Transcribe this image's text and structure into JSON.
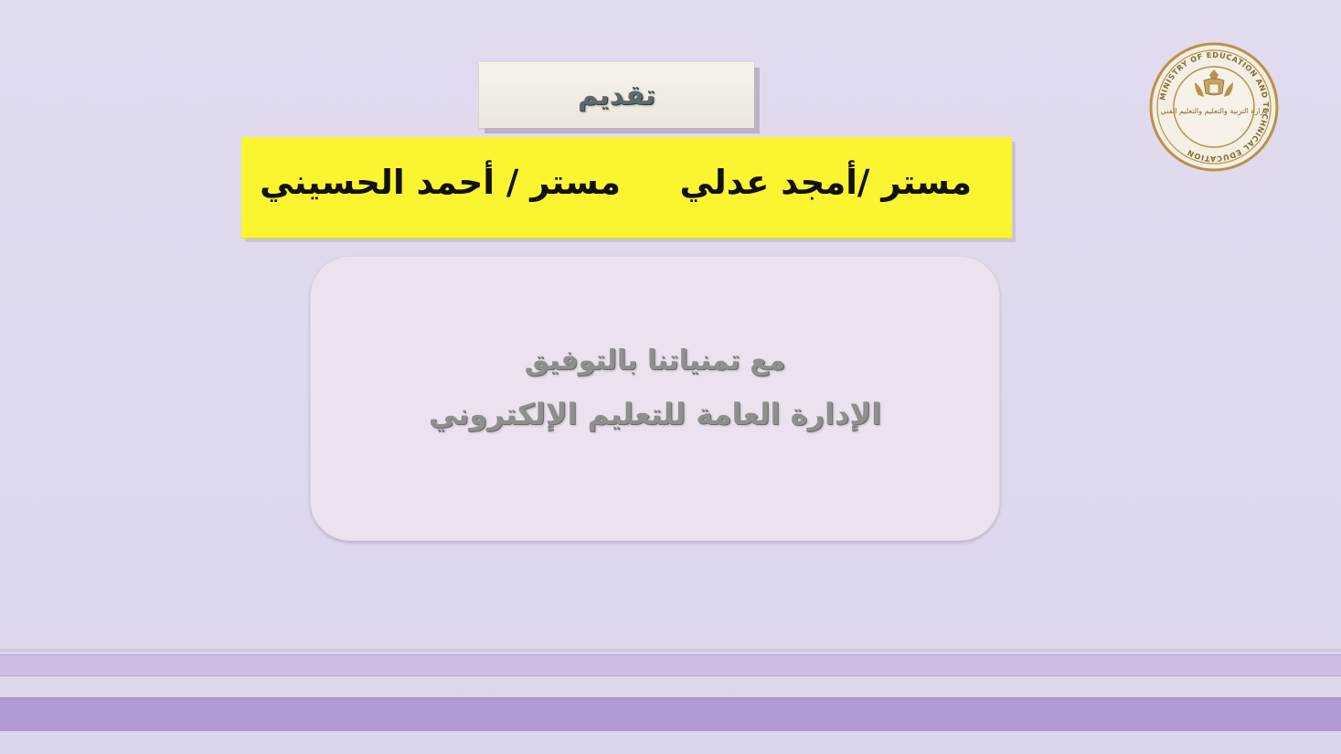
{
  "presenter_label": "تقديم",
  "presenters": [
    {
      "name": "مستر /أمجد عدلي"
    },
    {
      "name": "مستر / أحمد الحسيني"
    }
  ],
  "message": {
    "wish": "مع تمنياتنا بالتوفيق",
    "department": "الإدارة العامة للتعليم الإلكتروني"
  },
  "logo": {
    "icon": "eagle-seal-icon",
    "ring_text": "MINISTRY OF EDUCATION AND TECHNICAL EDUCATION",
    "arabic_text": "وزارة التربية والتعليم والتعليم الفني"
  },
  "colors": {
    "background": "#e0d9ec",
    "banner_yellow": "#fbf430",
    "card": "#ece2ef",
    "stripe_light": "#cdbde6",
    "stripe_dark": "#b199d3",
    "logo_gold": "#b8924a"
  }
}
